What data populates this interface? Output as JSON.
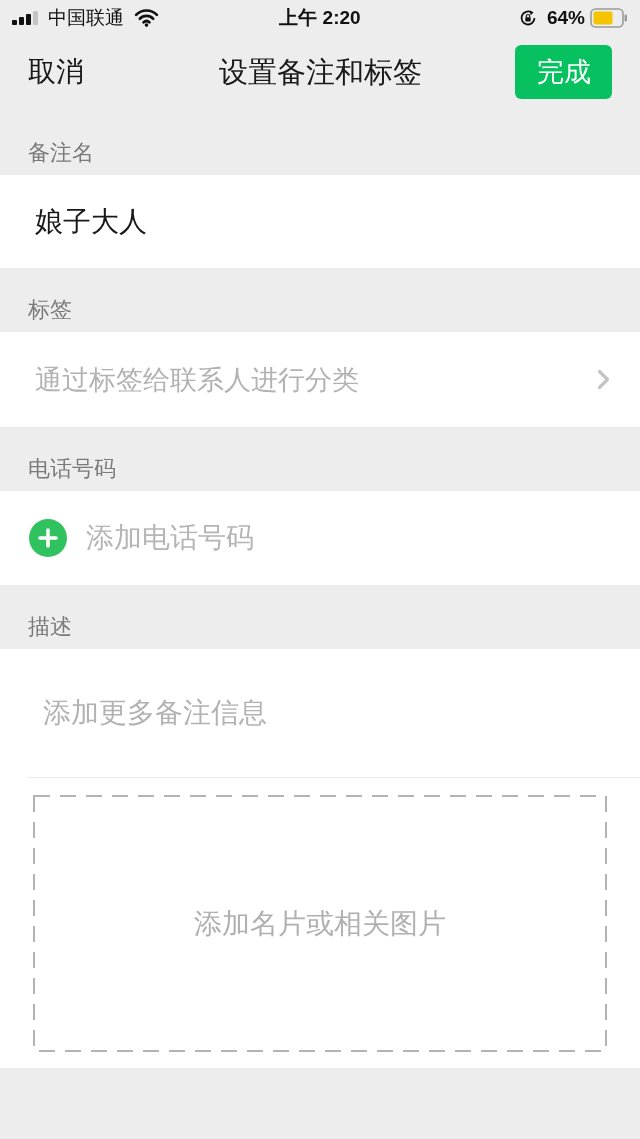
{
  "status_bar": {
    "carrier": "中国联通",
    "time": "上午 2:20",
    "battery": "64%"
  },
  "nav_bar": {
    "cancel": "取消",
    "title": "设置备注和标签",
    "done": "完成"
  },
  "sections": [
    {
      "label": "备注名",
      "kind": "text",
      "value": "娘子大人"
    },
    {
      "label": "标签",
      "kind": "link",
      "hint": "通过标签给联系人进行分类"
    },
    {
      "label": "电话号码",
      "kind": "add",
      "action": "添加电话号码"
    },
    {
      "label": "描述",
      "kind": "description",
      "placeholder": "添加更多备注信息",
      "image_hint": "添加名片或相关图片"
    }
  ]
}
